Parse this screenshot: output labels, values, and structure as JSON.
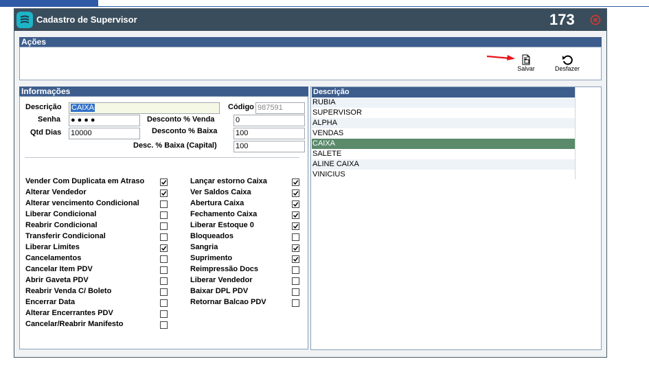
{
  "window": {
    "title": "Cadastro de Supervisor",
    "record_number": "173",
    "close_icon": "close-circle-icon",
    "accent": "#3a4d5c"
  },
  "acoes": {
    "header": "Ações",
    "salvar_label": "Salvar",
    "desfazer_label": "Desfazer"
  },
  "info": {
    "header": "Informações",
    "descricao_label": "Descrição",
    "descricao_value": "CAIXA",
    "codigo_label": "Código",
    "codigo_value": "987591",
    "senha_label": "Senha",
    "senha_value": "●●●●",
    "qtd_dias_label": "Qtd Dias",
    "qtd_dias_value": "10000",
    "desconto_venda_label": "Desconto % Venda",
    "desconto_venda_value": "0",
    "desconto_baixa_label": "Desconto % Baixa",
    "desconto_baixa_value": "100",
    "desc_baixa_capital_label": "Desc. % Baixa (Capital)",
    "desc_baixa_capital_value": "100"
  },
  "permissions_left": [
    {
      "label": "Vender Com Duplicata em Atraso",
      "checked": true
    },
    {
      "label": "Alterar Vendedor",
      "checked": true
    },
    {
      "label": "Alterar vencimento Condicional",
      "checked": false
    },
    {
      "label": "Liberar Condicional",
      "checked": false
    },
    {
      "label": "Reabrir Condicional",
      "checked": false
    },
    {
      "label": "Transferir Condicional",
      "checked": false
    },
    {
      "label": "Liberar Limites",
      "checked": true
    },
    {
      "label": "Cancelamentos",
      "checked": false
    },
    {
      "label": "Cancelar Item PDV",
      "checked": false
    },
    {
      "label": "Abrir Gaveta PDV",
      "checked": false
    },
    {
      "label": "Reabrir Venda C/ Boleto",
      "checked": false
    },
    {
      "label": "Encerrar Data",
      "checked": false
    },
    {
      "label": "Alterar Encerrantes PDV",
      "checked": false
    },
    {
      "label": "Cancelar/Reabrir Manifesto",
      "checked": false
    }
  ],
  "permissions_right": [
    {
      "label": "Lançar estorno Caixa",
      "checked": true
    },
    {
      "label": "Ver Saldos Caixa",
      "checked": true
    },
    {
      "label": "Abertura Caixa",
      "checked": true
    },
    {
      "label": "Fechamento Caixa",
      "checked": true
    },
    {
      "label": "Liberar Estoque 0",
      "checked": true
    },
    {
      "label": "Bloqueados",
      "checked": false
    },
    {
      "label": "Sangria",
      "checked": true
    },
    {
      "label": "Suprimento",
      "checked": true
    },
    {
      "label": "Reimpressão Docs",
      "checked": false
    },
    {
      "label": "Liberar Vendedor",
      "checked": false
    },
    {
      "label": "Baixar DPL PDV",
      "checked": false
    },
    {
      "label": "Retornar Balcao PDV",
      "checked": false
    }
  ],
  "list": {
    "header": "Descrição",
    "items": [
      "RUBIA",
      "SUPERVISOR",
      "ALPHA",
      "VENDAS",
      "CAIXA",
      "SALETE",
      "ALINE CAIXA",
      "VINICIUS"
    ],
    "selected_index": 4
  }
}
